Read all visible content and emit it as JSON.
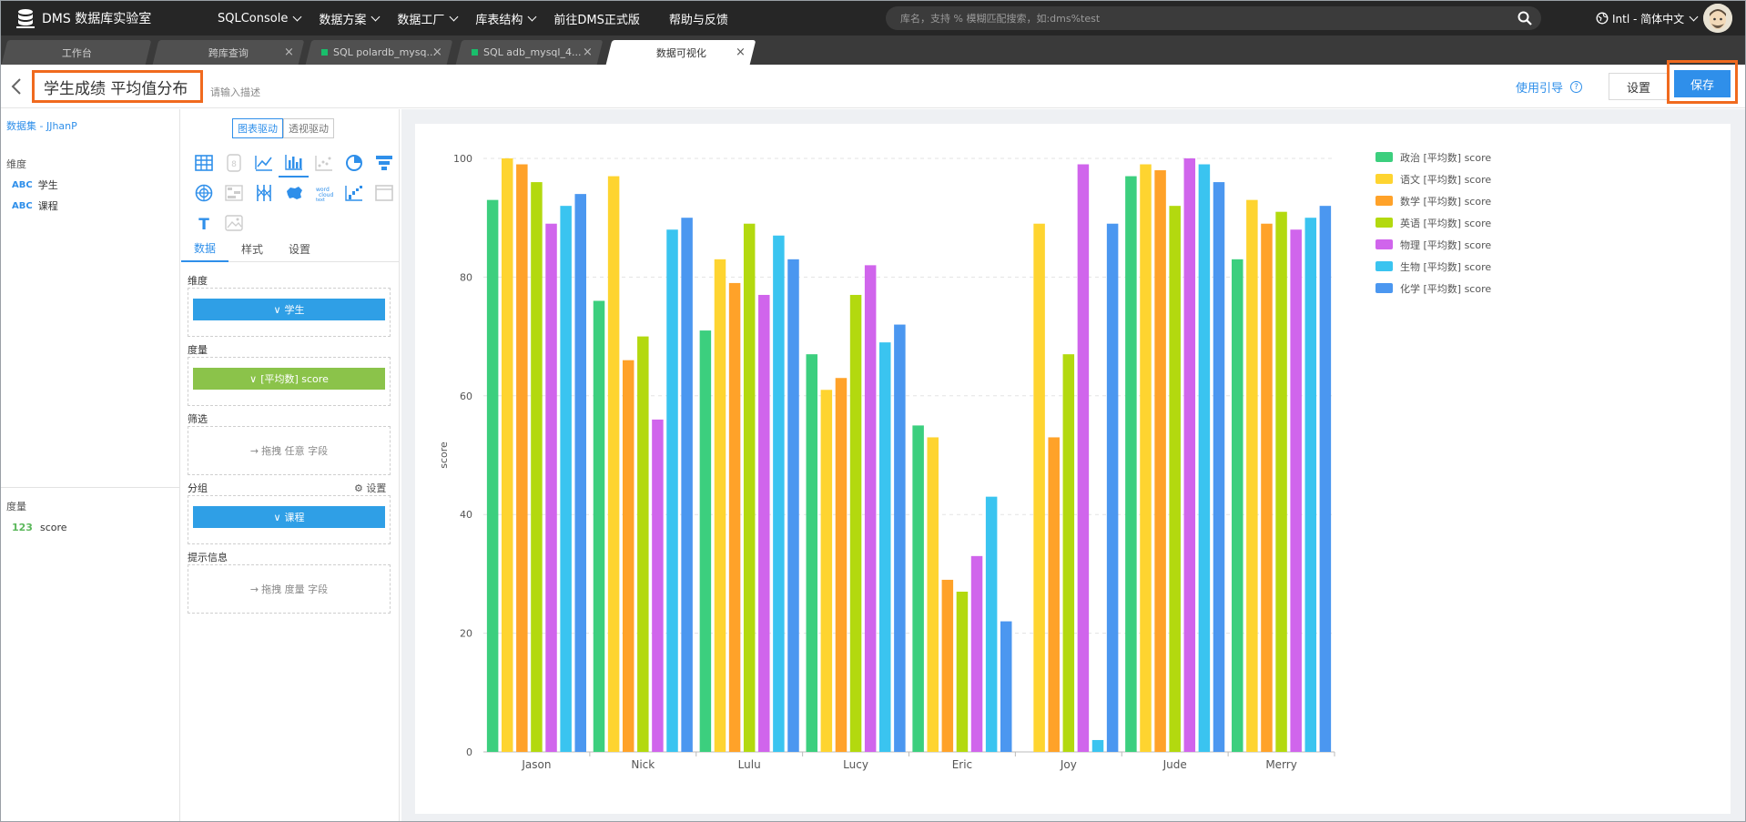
{
  "app": {
    "name": "DMS 数据库实验室"
  },
  "nav": {
    "items": [
      {
        "label": "SQLConsole",
        "has_dropdown": true
      },
      {
        "label": "数据方案",
        "has_dropdown": true
      },
      {
        "label": "数据工厂",
        "has_dropdown": true
      },
      {
        "label": "库表结构",
        "has_dropdown": true
      },
      {
        "label": "前往DMS正式版",
        "has_dropdown": false
      },
      {
        "label": "帮助与反馈",
        "has_dropdown": false
      }
    ],
    "search_placeholder": "库名，支持 % 模糊匹配搜索，如:dms%test",
    "lang_label": "Intl - 简体中文"
  },
  "tabs": [
    {
      "label": "工作台",
      "closable": false,
      "dot": false,
      "active": false
    },
    {
      "label": "跨库查询",
      "closable": true,
      "dot": false,
      "active": false
    },
    {
      "label": "SQL polardb_mysq...",
      "closable": true,
      "dot": true,
      "active": false
    },
    {
      "label": "SQL adb_mysql_4...",
      "closable": true,
      "dot": true,
      "active": false
    },
    {
      "label": "数据可视化",
      "closable": true,
      "dot": false,
      "active": true
    }
  ],
  "titlebar": {
    "title": "学生成绩 平均值分布",
    "description_placeholder": "请输入描述",
    "guide_label": "使用引导",
    "settings_label": "设置",
    "save_label": "保存"
  },
  "left_panel": {
    "dataset_label": "数据集 - JJhanP",
    "dimensions_label": "维度",
    "dimensions": [
      {
        "type": "ABC",
        "name": "学生"
      },
      {
        "type": "ABC",
        "name": "课程"
      }
    ],
    "measures_label": "度量",
    "measures": [
      {
        "type": "123",
        "name": "score"
      }
    ]
  },
  "config": {
    "toggle": {
      "chart_driven": "图表驱动",
      "pivot_driven": "透视驱动"
    },
    "chart_icons": [
      "table-icon",
      "indicator-icon",
      "line-chart-icon",
      "bar-chart-icon",
      "scatter-chart-icon",
      "pie-chart-icon",
      "funnel-chart-icon",
      "radar-chart-icon",
      "heatmap-icon",
      "parallel-icon",
      "china-map-icon",
      "wordcloud-icon",
      "waterfall-chart-icon",
      "frame-icon",
      "text-icon",
      "image-icon"
    ],
    "tabs": [
      "数据",
      "样式",
      "设置"
    ],
    "dimension_label": "维度",
    "dimension_pill": "学生",
    "measure_label": "度量",
    "measure_pill": "[平均数] score",
    "filter_label": "筛选",
    "filter_hint": "拖拽 任意 字段",
    "group_label": "分组",
    "group_settings": "设置",
    "group_pill": "课程",
    "tooltip_label": "提示信息",
    "tooltip_hint": "拖拽 度量 字段"
  },
  "chart_data": {
    "type": "bar",
    "categories": [
      "Jason",
      "Nick",
      "Lulu",
      "Lucy",
      "Eric",
      "Joy",
      "Jude",
      "Merry"
    ],
    "ylabel": "score",
    "ylim": [
      0,
      100
    ],
    "yticks": [
      0,
      20,
      40,
      60,
      80,
      100
    ],
    "grid": true,
    "legend_position": "top-right",
    "series": [
      {
        "name": "政治 [平均数] score",
        "color": "#3ccf7e",
        "values": [
          93,
          76,
          71,
          67,
          55,
          null,
          97,
          83
        ]
      },
      {
        "name": "语文 [平均数] score",
        "color": "#fed430",
        "values": [
          100,
          97,
          83,
          61,
          53,
          89,
          99,
          93
        ]
      },
      {
        "name": "数学 [平均数] score",
        "color": "#ffa229",
        "values": [
          99,
          66,
          79,
          63,
          29,
          53,
          98,
          89
        ]
      },
      {
        "name": "英语 [平均数] score",
        "color": "#b3d90f",
        "values": [
          96,
          70,
          89,
          77,
          27,
          67,
          92,
          91
        ]
      },
      {
        "name": "物理 [平均数] score",
        "color": "#d065ec",
        "values": [
          89,
          56,
          77,
          82,
          33,
          99,
          100,
          88
        ]
      },
      {
        "name": "生物 [平均数] score",
        "color": "#3ac4f0",
        "values": [
          92,
          88,
          87,
          69,
          43,
          2,
          99,
          90
        ]
      },
      {
        "name": "化学 [平均数] score",
        "color": "#4b97f0",
        "values": [
          94,
          90,
          83,
          72,
          22,
          89,
          96,
          92
        ]
      }
    ]
  }
}
